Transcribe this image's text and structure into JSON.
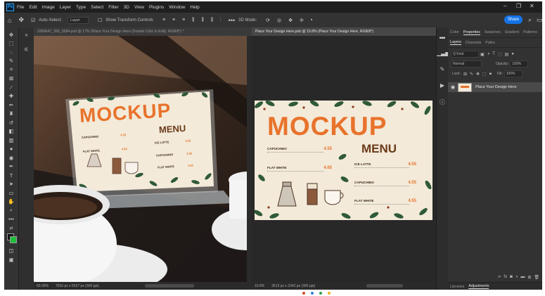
{
  "menubar": {
    "logo": "Ps",
    "items": [
      "File",
      "Edit",
      "Image",
      "Layer",
      "Type",
      "Select",
      "Filter",
      "3D",
      "View",
      "Plugins",
      "Window",
      "Help"
    ]
  },
  "optbar": {
    "auto_select_label": "Auto-Select:",
    "auto_select_value": "Layer",
    "transform_label": "Show Transform Controls",
    "mode_label": "3D Mode:",
    "share_label": "Share"
  },
  "documents": {
    "tab1": "3369647_390_3584.psd @ 17% (Place Your Design Here (Double Click to Edit), RGB/8*) *",
    "tab2": "Place Your Design Here.psb @ 19.8% (Place Your Design Here, RGB/8*)",
    "status1_zoom": "60.00%",
    "status1_size": "7016 px x 5527 px (300 ppi)",
    "status2_zoom": "19.8%",
    "status2_size": "3513 px x 2342 px (300 ppi)"
  },
  "mockup": {
    "title": "MOCKUP",
    "subtitle": "MENU",
    "items_left": [
      {
        "name": "CAPUCHINO",
        "price": "4.55"
      },
      {
        "name": "FLAT WHITE",
        "price": "4.65"
      }
    ],
    "items_right": [
      {
        "name": "ICE LATTE",
        "price": "4.55"
      },
      {
        "name": "CAPUCHINO",
        "price": "4.55"
      },
      {
        "name": "FLAT WHITE",
        "price": "4.55"
      }
    ]
  },
  "panel": {
    "tabs_top": [
      "Color",
      "Properties",
      "Swatches",
      "Gradient",
      "Patterns"
    ],
    "tabs_layers": [
      "Layers",
      "Channels",
      "Paths"
    ],
    "kind_label": "Q Kind",
    "blend_mode": "Normal",
    "opacity_label": "Opacity:",
    "opacity_value": "100%",
    "lock_label": "Lock:",
    "fill_label": "Fill:",
    "fill_value": "100%",
    "layer_name": "Place Your Design Here",
    "tabs_bottom": [
      "Libraries",
      "Adjustments"
    ]
  },
  "colors": {
    "accent_orange": "#e8732c",
    "menu_brown": "#6a3a1a",
    "share_blue": "#1473e6",
    "paper": "#f3ead9"
  }
}
